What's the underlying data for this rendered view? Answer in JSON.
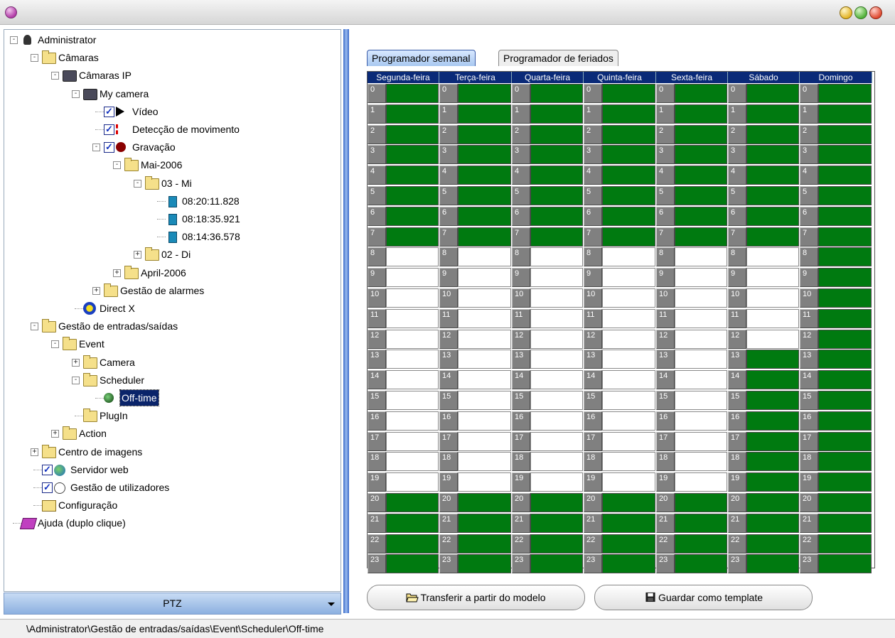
{
  "window": {
    "title": ""
  },
  "tree": {
    "nodes": [
      {
        "label": "Administrator",
        "icon": "admin-icon"
      },
      {
        "label": "Câmaras",
        "icon": "folder-open-icon"
      },
      {
        "label": "Câmaras IP",
        "icon": "ip-cameras-icon"
      },
      {
        "label": "My camera",
        "icon": "camera-icon"
      },
      {
        "label": "Vídeo",
        "icon": "play-icon",
        "checked": true
      },
      {
        "label": "Detecção de movimento",
        "icon": "motion-icon",
        "checked": true
      },
      {
        "label": "Gravação",
        "icon": "record-icon",
        "checked": true
      },
      {
        "label": "Mai-2006",
        "icon": "folder-open-icon"
      },
      {
        "label": "03 - Mi",
        "icon": "folder-open-icon"
      },
      {
        "label": "08:20:11.828",
        "icon": "recording-file-icon"
      },
      {
        "label": "08:18:35.921",
        "icon": "recording-file-icon"
      },
      {
        "label": "08:14:36.578",
        "icon": "recording-file-icon"
      },
      {
        "label": "02 - Di",
        "icon": "folder-icon"
      },
      {
        "label": "April-2006",
        "icon": "folder-icon"
      },
      {
        "label": "Gestão de alarmes",
        "icon": "folder-icon"
      },
      {
        "label": "Direct X",
        "icon": "directx-icon"
      },
      {
        "label": "Gestão de entradas/saídas",
        "icon": "folder-open-icon"
      },
      {
        "label": "Event",
        "icon": "folder-open-icon"
      },
      {
        "label": "Camera",
        "icon": "folder-icon"
      },
      {
        "label": "Scheduler",
        "icon": "folder-open-icon"
      },
      {
        "label": "Off-time",
        "icon": "clock-icon",
        "selected": true
      },
      {
        "label": "PlugIn",
        "icon": "folder-icon"
      },
      {
        "label": "Action",
        "icon": "folder-icon"
      },
      {
        "label": "Centro de imagens",
        "icon": "folder-icon"
      },
      {
        "label": "Servidor web",
        "icon": "globe-icon",
        "checked": true
      },
      {
        "label": "Gestão de utilizadores",
        "icon": "users-icon",
        "checked": true
      },
      {
        "label": "Configuração",
        "icon": "config-icon"
      },
      {
        "label": "Ajuda (duplo clique)",
        "icon": "help-book-icon"
      }
    ]
  },
  "ptz": {
    "label": "PTZ"
  },
  "tabs": [
    {
      "label": "Programador semanal",
      "active": true
    },
    {
      "label": "Programador de feriados",
      "active": false
    }
  ],
  "schedule": {
    "days": [
      "Segunda-feira",
      "Terça-feira",
      "Quarta-feira",
      "Quinta-feira",
      "Sexta-feira",
      "Sábado",
      "Domingo"
    ],
    "hours": [
      "0",
      "1",
      "2",
      "3",
      "4",
      "5",
      "6",
      "7",
      "8",
      "9",
      "10",
      "11",
      "12",
      "13",
      "14",
      "15",
      "16",
      "17",
      "18",
      "19",
      "20",
      "21",
      "22",
      "23"
    ],
    "active_hours": [
      [
        0,
        1,
        2,
        3,
        4,
        5,
        6,
        7,
        20,
        21,
        22,
        23
      ],
      [
        0,
        1,
        2,
        3,
        4,
        5,
        6,
        7,
        20,
        21,
        22,
        23
      ],
      [
        0,
        1,
        2,
        3,
        4,
        5,
        6,
        7,
        20,
        21,
        22,
        23
      ],
      [
        0,
        1,
        2,
        3,
        4,
        5,
        6,
        7,
        20,
        21,
        22,
        23
      ],
      [
        0,
        1,
        2,
        3,
        4,
        5,
        6,
        7,
        20,
        21,
        22,
        23
      ],
      [
        0,
        1,
        2,
        3,
        4,
        5,
        6,
        7,
        13,
        14,
        15,
        16,
        17,
        18,
        19,
        20,
        21,
        22,
        23
      ],
      [
        0,
        1,
        2,
        3,
        4,
        5,
        6,
        7,
        8,
        9,
        10,
        11,
        12,
        13,
        14,
        15,
        16,
        17,
        18,
        19,
        20,
        21,
        22,
        23
      ]
    ],
    "active_color": "#007a10",
    "header_color": "#0a2a78"
  },
  "buttons": {
    "transfer": "Transferir a partir do modelo",
    "save": "Guardar como template"
  },
  "status": {
    "path": "\\Administrator\\Gestão de entradas/saídas\\Event\\Scheduler\\Off-time"
  }
}
